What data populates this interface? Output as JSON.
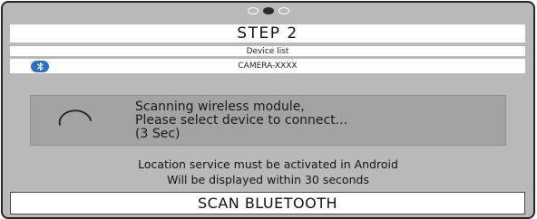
{
  "pager": {
    "count": 3,
    "active_index": 1
  },
  "step": {
    "title": "STEP 2"
  },
  "device_list": {
    "header": "Device list",
    "devices": [
      {
        "name": "CAMERA-XXXX",
        "icon": "bluetooth-icon"
      }
    ]
  },
  "scan_status": {
    "line1": "Scanning wireless module,",
    "line2": "Please select device to connect...",
    "line3": "(3 Sec)",
    "icon": "loading-spinner-icon"
  },
  "notes": {
    "line1": "Location service must be activated in Android",
    "line2": "Will be displayed within 30 seconds"
  },
  "actions": {
    "scan_label": "SCAN BLUETOOTH"
  },
  "colors": {
    "panel_background": "#b9b9b9",
    "bluetooth_badge": "#2f6fc1",
    "active_dot": "#2b2b2b"
  }
}
